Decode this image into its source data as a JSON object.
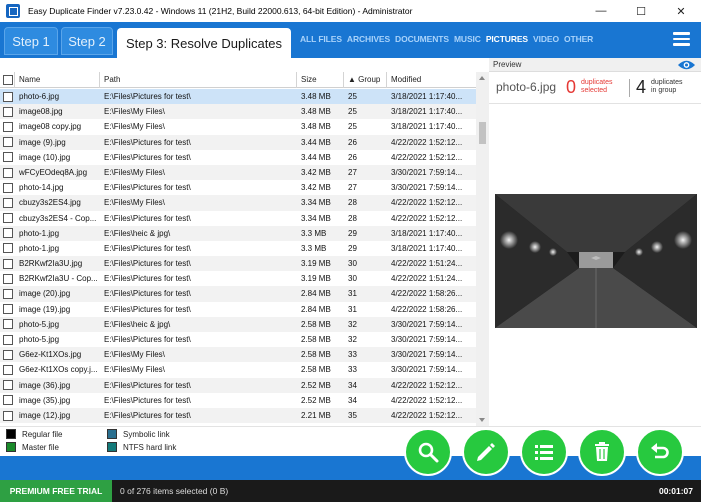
{
  "window": {
    "title": "Easy Duplicate Finder v7.23.0.42 - Windows 11 (21H2, Build 22000.613, 64-bit Edition) - Administrator",
    "minimize": "—",
    "maximize": "☐",
    "close": "✕"
  },
  "steps": [
    {
      "label": "Step 1"
    },
    {
      "label": "Step 2"
    },
    {
      "label": "Step 3: Resolve Duplicates"
    }
  ],
  "categories": [
    "ALL FILES",
    "ARCHIVES",
    "DOCUMENTS",
    "MUSIC",
    "PICTURES",
    "VIDEO",
    "OTHER"
  ],
  "active_category": "PICTURES",
  "table": {
    "headers": [
      "Name",
      "Path",
      "Size",
      "▲ Group",
      "Modified"
    ],
    "rows": [
      {
        "name": "photo-6.jpg",
        "path": "E:\\Files\\Pictures for test\\",
        "size": "3.48 MB",
        "group": "25",
        "modified": "3/18/2021 1:17:40..."
      },
      {
        "name": "image08.jpg",
        "path": "E:\\Files\\My Files\\",
        "size": "3.48 MB",
        "group": "25",
        "modified": "3/18/2021 1:17:40..."
      },
      {
        "name": "image08 copy.jpg",
        "path": "E:\\Files\\My Files\\",
        "size": "3.48 MB",
        "group": "25",
        "modified": "3/18/2021 1:17:40..."
      },
      {
        "name": "image (9).jpg",
        "path": "E:\\Files\\Pictures for test\\",
        "size": "3.44 MB",
        "group": "26",
        "modified": "4/22/2022 1:52:12..."
      },
      {
        "name": "image (10).jpg",
        "path": "E:\\Files\\Pictures for test\\",
        "size": "3.44 MB",
        "group": "26",
        "modified": "4/22/2022 1:52:12..."
      },
      {
        "name": "wFCyEOdeq8A.jpg",
        "path": "E:\\Files\\My Files\\",
        "size": "3.42 MB",
        "group": "27",
        "modified": "3/30/2021 7:59:14..."
      },
      {
        "name": "photo-14.jpg",
        "path": "E:\\Files\\Pictures for test\\",
        "size": "3.42 MB",
        "group": "27",
        "modified": "3/30/2021 7:59:14..."
      },
      {
        "name": "cbuzy3s2ES4.jpg",
        "path": "E:\\Files\\My Files\\",
        "size": "3.34 MB",
        "group": "28",
        "modified": "4/22/2022 1:52:12..."
      },
      {
        "name": "cbuzy3s2ES4 - Cop...",
        "path": "E:\\Files\\Pictures for test\\",
        "size": "3.34 MB",
        "group": "28",
        "modified": "4/22/2022 1:52:12..."
      },
      {
        "name": "photo-1.jpg",
        "path": "E:\\Files\\heic & jpg\\",
        "size": "3.3 MB",
        "group": "29",
        "modified": "3/18/2021 1:17:40..."
      },
      {
        "name": "photo-1.jpg",
        "path": "E:\\Files\\Pictures for test\\",
        "size": "3.3 MB",
        "group": "29",
        "modified": "3/18/2021 1:17:40..."
      },
      {
        "name": "B2RKwf2Ia3U.jpg",
        "path": "E:\\Files\\Pictures for test\\",
        "size": "3.19 MB",
        "group": "30",
        "modified": "4/22/2022 1:51:24..."
      },
      {
        "name": "B2RKwf2Ia3U - Cop...",
        "path": "E:\\Files\\Pictures for test\\",
        "size": "3.19 MB",
        "group": "30",
        "modified": "4/22/2022 1:51:24..."
      },
      {
        "name": "image (20).jpg",
        "path": "E:\\Files\\Pictures for test\\",
        "size": "2.84 MB",
        "group": "31",
        "modified": "4/22/2022 1:58:26..."
      },
      {
        "name": "image (19).jpg",
        "path": "E:\\Files\\Pictures for test\\",
        "size": "2.84 MB",
        "group": "31",
        "modified": "4/22/2022 1:58:26..."
      },
      {
        "name": "photo-5.jpg",
        "path": "E:\\Files\\heic & jpg\\",
        "size": "2.58 MB",
        "group": "32",
        "modified": "3/30/2021 7:59:14..."
      },
      {
        "name": "photo-5.jpg",
        "path": "E:\\Files\\Pictures for test\\",
        "size": "2.58 MB",
        "group": "32",
        "modified": "3/30/2021 7:59:14..."
      },
      {
        "name": "G6ez-Kt1XOs.jpg",
        "path": "E:\\Files\\My Files\\",
        "size": "2.58 MB",
        "group": "33",
        "modified": "3/30/2021 7:59:14..."
      },
      {
        "name": "G6ez-Kt1XOs copy.j...",
        "path": "E:\\Files\\My Files\\",
        "size": "2.58 MB",
        "group": "33",
        "modified": "3/30/2021 7:59:14..."
      },
      {
        "name": "image (36).jpg",
        "path": "E:\\Files\\Pictures for test\\",
        "size": "2.52 MB",
        "group": "34",
        "modified": "4/22/2022 1:52:12..."
      },
      {
        "name": "image (35).jpg",
        "path": "E:\\Files\\Pictures for test\\",
        "size": "2.52 MB",
        "group": "34",
        "modified": "4/22/2022 1:52:12..."
      },
      {
        "name": "image (12).jpg",
        "path": "E:\\Files\\Pictures for test\\",
        "size": "2.21 MB",
        "group": "35",
        "modified": "4/22/2022 1:52:12..."
      }
    ]
  },
  "preview": {
    "label": "Preview",
    "file_name": "photo-6.jpg",
    "selected_count": "0",
    "selected_label_1": "duplicates",
    "selected_label_2": "selected",
    "group_count": "4",
    "group_label_1": "duplicates",
    "group_label_2": "in group"
  },
  "legend": {
    "regular": "Regular file",
    "master": "Master file",
    "symbolic": "Symbolic link",
    "hardlink": "NTFS hard link",
    "colors": {
      "regular": "#000000",
      "master": "#1a8a2a",
      "symbolic": "#2a6f8f",
      "hardlink": "#137a7a"
    }
  },
  "actions": [
    "search-icon",
    "edit-icon",
    "list-icon",
    "trash-icon",
    "undo-icon"
  ],
  "status": {
    "trial": "PREMIUM FREE TRIAL",
    "selection": "0 of 276 items selected (0 B)",
    "timer": "00:01:07"
  },
  "colors": {
    "accent": "#1976d2",
    "green": "#27c93f",
    "trial": "#2ea043",
    "duplicates_red": "#e53935"
  }
}
